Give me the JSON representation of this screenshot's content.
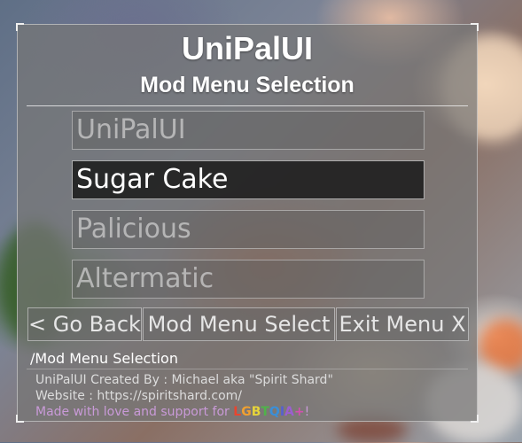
{
  "window": {
    "title": "UniPalUI",
    "subtitle": "Mod Menu Selection"
  },
  "menu": {
    "items": [
      {
        "label": "UniPalUI",
        "state": "dimmed"
      },
      {
        "label": "Sugar Cake",
        "state": "selected"
      },
      {
        "label": "Palicious",
        "state": "dimmed"
      },
      {
        "label": "Altermatic",
        "state": "dimmed"
      }
    ]
  },
  "nav": {
    "back_label": "< Go Back",
    "select_label": "Mod Menu Select",
    "exit_label": "Exit Menu X"
  },
  "breadcrumb": "/Mod Menu Selection",
  "footer": {
    "credit": "UniPalUI Created By : Michael aka \"Spirit Shard\"",
    "website": "Website : https://spiritshard.com/",
    "love_prefix": "Made with love and support for ",
    "pride_letters": [
      {
        "char": "L",
        "color": "#e8452f"
      },
      {
        "char": "G",
        "color": "#f0a030"
      },
      {
        "char": "B",
        "color": "#e6d43a"
      },
      {
        "char": "T",
        "color": "#4fb34a"
      },
      {
        "char": "Q",
        "color": "#3a8fd8"
      },
      {
        "char": "I",
        "color": "#5560d0"
      },
      {
        "char": "A",
        "color": "#9b5fd0"
      },
      {
        "char": "+",
        "color": "#d34fb0"
      }
    ],
    "love_suffix": "!"
  },
  "colors": {
    "panel_bg": "#767676",
    "selected_bg": "#1c1c1c",
    "text_white": "#ffffff",
    "love_text": "#c99ad8"
  }
}
